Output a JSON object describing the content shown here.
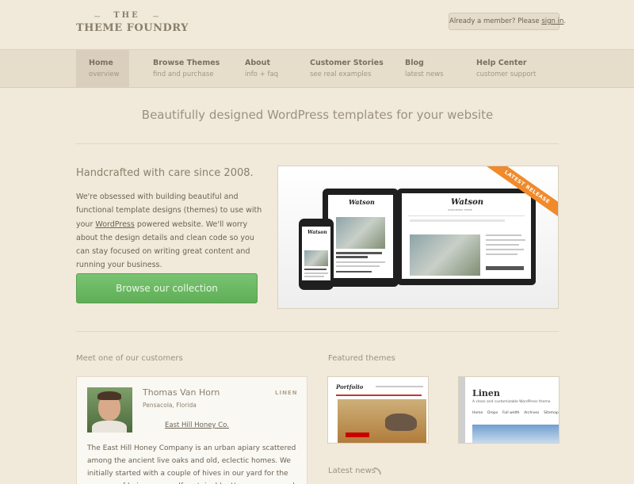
{
  "logo": {
    "the": "THE",
    "main": "THEME FOUNDRY"
  },
  "member": {
    "text": "Already a member? Please ",
    "link": "sign in",
    "suffix": "."
  },
  "nav": [
    {
      "label": "Home",
      "sub": "overview"
    },
    {
      "label": "Browse Themes",
      "sub": "find and purchase"
    },
    {
      "label": "About",
      "sub": "info + faq"
    },
    {
      "label": "Customer Stories",
      "sub": "see real examples"
    },
    {
      "label": "Blog",
      "sub": "latest news"
    },
    {
      "label": "Help Center",
      "sub": "customer support"
    }
  ],
  "tagline": "Beautifully designed WordPress templates for your website",
  "intro": {
    "heading": "Handcrafted with care since 2008.",
    "text_before": "We're obsessed with building beautiful and functional template designs (themes) to use with your ",
    "link": "WordPress",
    "text_after": " powered website. We'll worry about the design details and clean code so you can stay focused on writing great content and running your business.",
    "button": "Browse our collection"
  },
  "hero": {
    "ribbon": "LATEST RELEASE",
    "theme_name": "Watson",
    "theme_tagline": "WORDPRESS THEME"
  },
  "customer": {
    "section_label": "Meet one of our customers",
    "name": "Thomas Van Horn",
    "theme": "LINEN",
    "location": "Pensacola, Florida",
    "company": "East Hill Honey Co.",
    "story": "The East Hill Honey Company is an urban apiary scattered among the ancient live oaks and old, eclectic homes. We initially started with a couple of hives in our yard for the purpose of being more self-sustainable. However, as word spread, neighbors started to"
  },
  "featured": {
    "section_label": "Featured themes",
    "theme1": {
      "logo": "Portfolio"
    },
    "theme2": {
      "title": "Linen",
      "subtitle": "A clean and customizable WordPress theme",
      "menu": [
        "Home",
        "Drops",
        "Full width",
        "Archives",
        "Sitemap"
      ]
    }
  },
  "latest_news": "Latest news",
  "colors": {
    "background": "#f1e9da",
    "nav_bg": "#e6ddcb",
    "button_green": "#6bb962",
    "ribbon_orange": "#f08a2a"
  }
}
